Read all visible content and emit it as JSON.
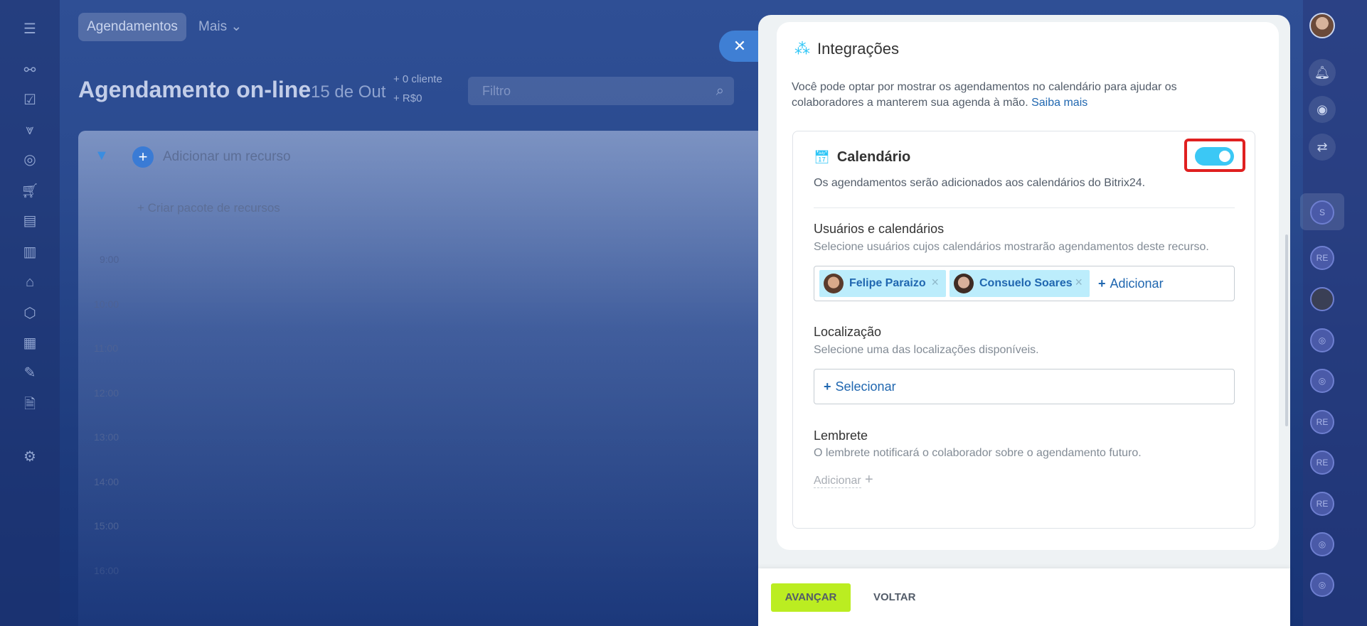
{
  "app": {
    "tabs": [
      {
        "label": "Agendamentos"
      },
      {
        "label": "Mais ⌄"
      }
    ],
    "title": "Agendamento on-line",
    "date": "15 de Out",
    "stats": [
      "+ 0 cliente",
      "+ R$0"
    ],
    "search_placeholder": "Filtro",
    "add_resource": "Adicionar um recurso",
    "create_pack": "+ Criar pacote de recursos",
    "times": [
      "9:00",
      "10:00",
      "11:00",
      "12:00",
      "13:00",
      "14:00",
      "15:00",
      "16:00"
    ]
  },
  "panel": {
    "heading": "Integrações",
    "description": "Você pode optar por mostrar os agendamentos no calendário para ajudar os colaboradores a manterem sua agenda à mão.",
    "learn_more": "Saiba mais",
    "calendar": {
      "title": "Calendário",
      "subtitle": "Os agendamentos serão adicionados aos calendários do Bitrix24.",
      "enabled": true
    },
    "users": {
      "title": "Usuários e calendários",
      "subtitle": "Selecione usuários cujos calendários mostrarão agendamentos deste recurso.",
      "selected": [
        {
          "name": "Felipe Paraizo"
        },
        {
          "name": "Consuelo Soares"
        }
      ],
      "add_label": "Adicionar"
    },
    "location": {
      "title": "Localização",
      "subtitle": "Selecione uma das localizações disponíveis.",
      "select_label": "Selecionar"
    },
    "reminder": {
      "title": "Lembrete",
      "subtitle": "O lembrete notificará o colaborador sobre o agendamento futuro.",
      "add_label": "Adicionar"
    },
    "buttons": {
      "next": "AVANÇAR",
      "back": "VOLTAR"
    }
  },
  "right_rail": {
    "chips": [
      "S",
      "RE",
      "",
      "",
      "",
      "RE",
      "RE",
      "RE",
      "",
      ""
    ]
  }
}
